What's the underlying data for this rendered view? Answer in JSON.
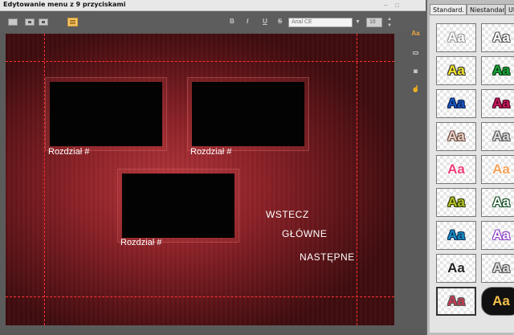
{
  "window": {
    "title": "Edytowanie menu z 9 przyciskami"
  },
  "toolbar": {
    "bold_label": "B",
    "italic_label": "I",
    "underline_label": "U",
    "strike_label": "S",
    "font_name": "Arial CE",
    "font_size": "16"
  },
  "side_icons": {
    "text_style_label": "Aa"
  },
  "canvas": {
    "chapter_labels": [
      "Rozdział #",
      "Rozdział #",
      "Rozdział #"
    ],
    "nav_back": "WSTECZ",
    "nav_main": "GŁÓWNE",
    "nav_next": "NASTĘPNE"
  },
  "panel": {
    "tabs": [
      "Standard.",
      "Niestandard.",
      "Ul"
    ],
    "styles": [
      {
        "label": "Aa",
        "color": "#ffffff",
        "outline": "#9a9a9a"
      },
      {
        "label": "Aa",
        "color": "#ffffff",
        "outline": "#555555"
      },
      {
        "label": "Aa",
        "color": "#f3e52b",
        "outline": "#333333"
      },
      {
        "label": "Aa",
        "color": "#19a43a",
        "outline": "#0b3b12"
      },
      {
        "label": "Aa",
        "color": "#1a57c4",
        "outline": "#0a1f4c"
      },
      {
        "label": "Aa",
        "color": "#c7175e",
        "outline": "#4a0620"
      },
      {
        "label": "Aa",
        "color": "#e8d2c8",
        "outline": "#6b4a40"
      },
      {
        "label": "Aa",
        "color": "#d8d8d8",
        "outline": "#555555"
      },
      {
        "label": "Aa",
        "color": "#ee3f7a",
        "outline": "#ffffff"
      },
      {
        "label": "Aa",
        "color": "#f1a25a",
        "outline": "#ffffff"
      },
      {
        "label": "Aa",
        "color": "#b5c22a",
        "outline": "#2d3a05"
      },
      {
        "label": "Aa",
        "color": "#ffffff",
        "outline": "#0d4a1d"
      },
      {
        "label": "Aa",
        "color": "#1a90c9",
        "outline": "#0b2f55"
      },
      {
        "label": "Aa",
        "color": "#ffffff",
        "outline": "#8b3fc5"
      },
      {
        "label": "Aa",
        "color": "#222222",
        "outline": "#ffffff"
      },
      {
        "label": "Aa",
        "color": "#dddddd",
        "outline": "#555555"
      },
      {
        "label": "Aa",
        "color": "#c93a52",
        "outline": "#555555"
      },
      {
        "label": "Aa",
        "color": "#f3c04a",
        "outline": "#111111"
      }
    ]
  }
}
